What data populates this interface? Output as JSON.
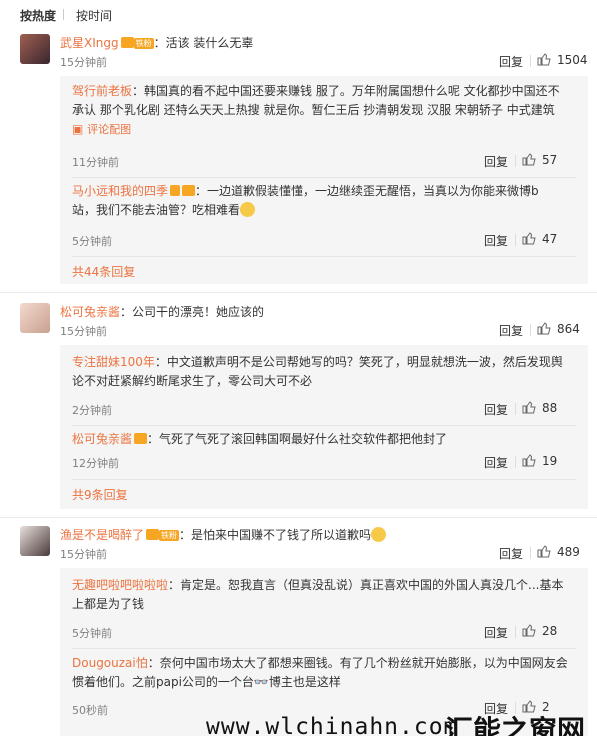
{
  "sort": {
    "hot": "按热度",
    "time": "按时间"
  },
  "comments": [
    {
      "user": "武星XIngg",
      "badge": "铁粉",
      "text": "：活该 装什么无辜",
      "time": "15分钟前",
      "reply_label": "回复",
      "likes": "1504",
      "replies": [
        {
          "user": "驾行前老板",
          "text1": "：韩国真的看不起中国还要来赚钱 服了。万年附属国想什么呢 文化都抄中国还不",
          "text2": "承认 那个乳化剧 还特么天天上热搜 就是你。暂仁王后 抄清朝发现 汉服 宋朝轿子 中式建筑",
          "quote_link": "评论配图",
          "time": "11分钟前",
          "reply_label": "回复",
          "likes": "57"
        },
        {
          "user": "马小远和我的四季",
          "text1": "：一边道歉假装懂懂，一边继续歪无醒悟，当真以为你能来微博b",
          "text2": "站，我们不能去油管？吃相难看",
          "time": "5分钟前",
          "reply_label": "回复",
          "likes": "47"
        }
      ],
      "more": "共44条回复"
    },
    {
      "user": "松可兔亲酱",
      "text": "：公司干的漂亮！她应该的",
      "time": "15分钟前",
      "reply_label": "回复",
      "likes": "864",
      "replies": [
        {
          "user": "专注甜妹100年",
          "text1": "：中文道歉声明不是公司帮她写的吗？笑死了，明显就想洗一波，然后发现舆",
          "text2": "论不对赶紧解约断尾求生了，零公司大可不必",
          "time": "2分钟前",
          "reply_label": "回复",
          "likes": "88"
        },
        {
          "user": "松可兔亲酱",
          "text1": "：气死了气死了滚回韩国啊最好什么社交软件都把他封了",
          "time": "12分钟前",
          "reply_label": "回复",
          "likes": "19"
        }
      ],
      "more": "共9条回复"
    },
    {
      "user": "渔是不是喝醉了",
      "badge": "铁粉",
      "text": "：是怕来中国赚不了钱了所以道歉吗",
      "time": "15分钟前",
      "reply_label": "回复",
      "likes": "489",
      "replies": [
        {
          "user": "无趣吧啦吧啦啦啦",
          "text1": "：肯定是。恕我直言（但真没乱说）真正喜欢中国的外国人真没几个...基本",
          "text2": "上都是为了钱",
          "time": "5分钟前",
          "reply_label": "回复",
          "likes": "28"
        },
        {
          "user": "Dougouzai怕",
          "text1": "：奈何中国市场太大了都想来圈钱。有了几个粉丝就开始膨胀，以为中国网友会",
          "text2": "惯着他们。之前papi公司的一个台👓博主也是这样",
          "time": "50秒前",
          "reply_label": "回复",
          "likes": "2"
        }
      ]
    }
  ],
  "watermark": {
    "url": "www.wlchinahn.com",
    "cn": "汇能之窗网"
  },
  "colors": {
    "link": "#eb7340",
    "gray": "#808080",
    "reply_bg": "#f5f5f5"
  }
}
